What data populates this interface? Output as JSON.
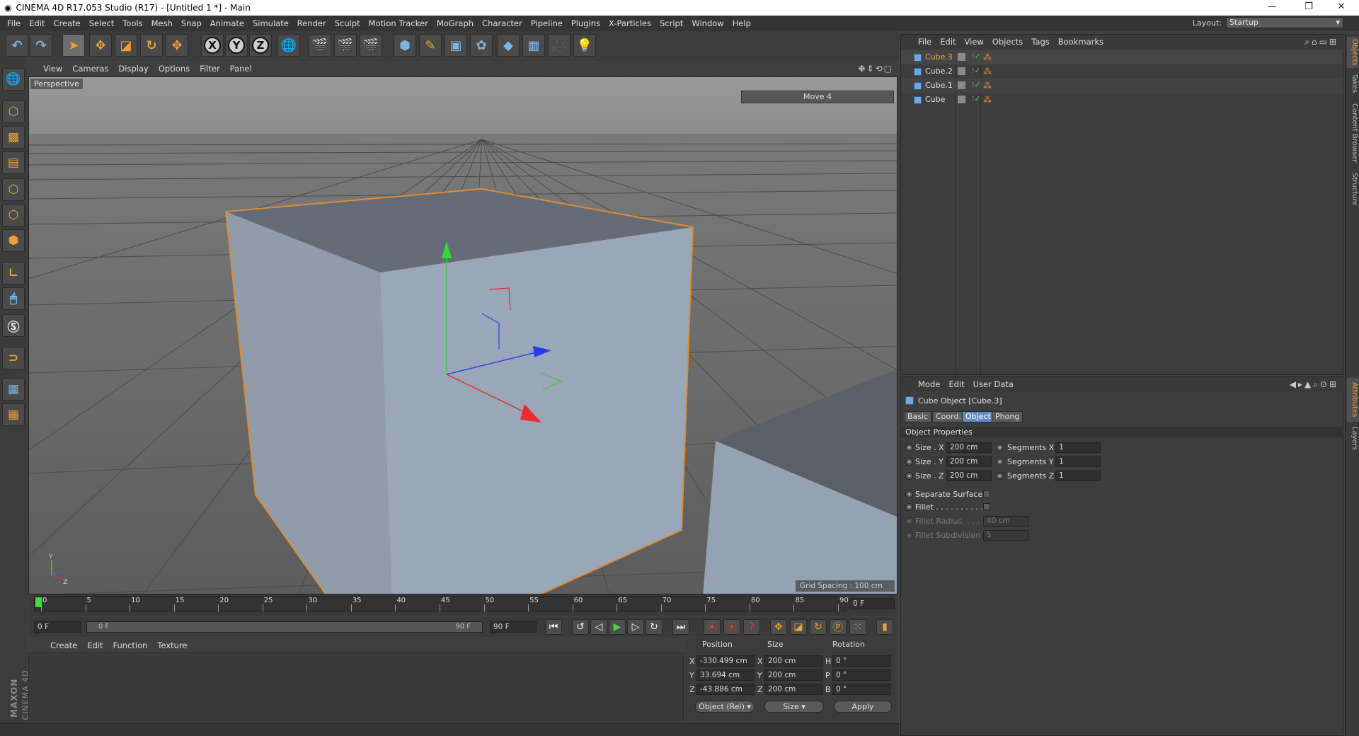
{
  "window": {
    "title": "CINEMA 4D R17.053 Studio (R17) - [Untitled 1 *] - Main"
  },
  "menu": [
    "File",
    "Edit",
    "Create",
    "Select",
    "Tools",
    "Mesh",
    "Snap",
    "Animate",
    "Simulate",
    "Render",
    "Sculpt",
    "Motion Tracker",
    "MoGraph",
    "Character",
    "Pipeline",
    "Plugins",
    "X-Particles",
    "Script",
    "Window",
    "Help"
  ],
  "layout": {
    "label": "Layout:",
    "value": "Startup"
  },
  "toolbar": {
    "axis_x": "X",
    "axis_y": "Y",
    "axis_z": "Z"
  },
  "viewport": {
    "menu": [
      "View",
      "Cameras",
      "Display",
      "Options",
      "Filter",
      "Panel"
    ],
    "camera_label": "Perspective",
    "hud_move": "Move 4",
    "grid_spacing": "Grid Spacing : 100 cm",
    "axis_y": "Y",
    "axis_z": "Z"
  },
  "timeline": {
    "ticks": [
      "0",
      "5",
      "10",
      "15",
      "20",
      "25",
      "30",
      "35",
      "40",
      "45",
      "50",
      "55",
      "60",
      "65",
      "70",
      "75",
      "80",
      "85",
      "90"
    ],
    "current_frame": "0 F",
    "start_field": "0 F",
    "range_start": "0 F",
    "range_end": "90 F",
    "end_field": "90 F"
  },
  "material": {
    "menu": [
      "Create",
      "Edit",
      "Function",
      "Texture"
    ],
    "brand_top": "MAXON",
    "brand_bottom": "CINEMA 4D"
  },
  "coordinates": {
    "headers": {
      "position": "Position",
      "size": "Size",
      "rotation": "Rotation"
    },
    "rows": [
      {
        "axis": "X",
        "pos": "-330.499 cm",
        "size_axis": "X",
        "size": "200 cm",
        "rot_axis": "H",
        "rot": "0 °"
      },
      {
        "axis": "Y",
        "pos": "33.694 cm",
        "size_axis": "Y",
        "size": "200 cm",
        "rot_axis": "P",
        "rot": "0 °"
      },
      {
        "axis": "Z",
        "pos": "-43.886 cm",
        "size_axis": "Z",
        "size": "200 cm",
        "rot_axis": "B",
        "rot": "0 °"
      }
    ],
    "mode": "Object (Rel)",
    "size_mode": "Size",
    "apply": "Apply"
  },
  "objects": {
    "menu": [
      "File",
      "Edit",
      "View",
      "Objects",
      "Tags",
      "Bookmarks"
    ],
    "items": [
      {
        "name": "Cube.3",
        "selected": true
      },
      {
        "name": "Cube.2",
        "selected": false
      },
      {
        "name": "Cube.1",
        "selected": false
      },
      {
        "name": "Cube",
        "selected": false
      }
    ]
  },
  "attributes": {
    "menu": [
      "Mode",
      "Edit",
      "User Data"
    ],
    "title": "Cube Object [Cube.3]",
    "tabs": [
      "Basic",
      "Coord.",
      "Object",
      "Phong"
    ],
    "active_tab": "Object",
    "section": "Object Properties",
    "size_x_label": "Size . X",
    "size_x": "200 cm",
    "size_y_label": "Size . Y",
    "size_y": "200 cm",
    "size_z_label": "Size . Z",
    "size_z": "200 cm",
    "seg_x_label": "Segments X",
    "seg_x": "1",
    "seg_y_label": "Segments Y",
    "seg_y": "1",
    "seg_z_label": "Segments Z",
    "seg_z": "1",
    "separate_surfaces": "Separate Surfaces",
    "fillet": "Fillet . . . . . . . . . . .",
    "fillet_radius_label": "Fillet Radius. . . . . .",
    "fillet_radius": "40 cm",
    "fillet_subdiv_label": "Fillet Subdivision",
    "fillet_subdiv": "5"
  },
  "side_tabs": [
    "Objects",
    "Takes",
    "Content Browser",
    "Structure",
    "Attributes",
    "Layers"
  ],
  "colors": {
    "accent": "#f0a030",
    "selection": "#5f8bc4",
    "cube_face": "#98a6b8"
  }
}
